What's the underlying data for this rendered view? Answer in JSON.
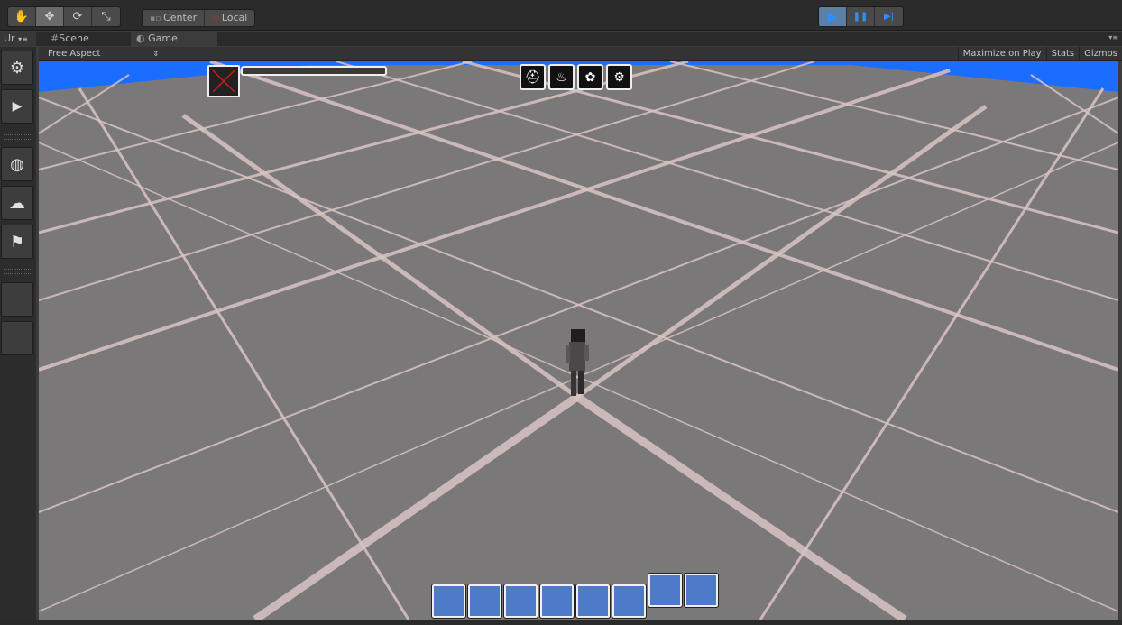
{
  "toolbar": {
    "tools": [
      {
        "name": "hand-tool-icon",
        "glyph": "✋"
      },
      {
        "name": "move-tool-icon",
        "glyph": "✥"
      },
      {
        "name": "rotate-tool-icon",
        "glyph": "⟳"
      },
      {
        "name": "scale-tool-icon",
        "glyph": "⤡"
      }
    ],
    "pivot_label": "Center",
    "space_label": "Local",
    "play_controls": [
      {
        "name": "play-icon",
        "glyph": "▶"
      },
      {
        "name": "pause-icon",
        "glyph": "❚❚"
      },
      {
        "name": "step-icon",
        "glyph": "▶|"
      }
    ]
  },
  "tabs": {
    "left_tab": "Ur",
    "scene_label": "Scene",
    "game_label": "Game"
  },
  "gamebar": {
    "aspect": "Free Aspect",
    "maximize": "Maximize on Play",
    "stats": "Stats",
    "gizmos": "Gizmos"
  },
  "sidebar": {
    "buttons": [
      {
        "name": "settings-gear-icon",
        "glyph": "⚙"
      },
      {
        "name": "play-arrow-icon",
        "glyph": "▶"
      },
      {
        "name": "terrain-add-icon",
        "glyph": "◍"
      },
      {
        "name": "tornado-add-icon",
        "glyph": "☁"
      },
      {
        "name": "character-add-icon",
        "glyph": "⚑"
      }
    ]
  },
  "hud": {
    "health_fill": 0.0,
    "ability_icons": [
      {
        "name": "helmet-icon",
        "glyph": "⛑"
      },
      {
        "name": "potion-icon",
        "glyph": "♨"
      },
      {
        "name": "gear-cluster-icon",
        "glyph": "✿"
      },
      {
        "name": "gears-icon",
        "glyph": "⚙"
      }
    ],
    "slot_count": 8
  },
  "colors": {
    "sky": "#1a6dff",
    "floor": "#7b7879",
    "grid": "#e8cfcf",
    "slot": "#4d7bc9",
    "accent_play": "#2f8fff"
  }
}
